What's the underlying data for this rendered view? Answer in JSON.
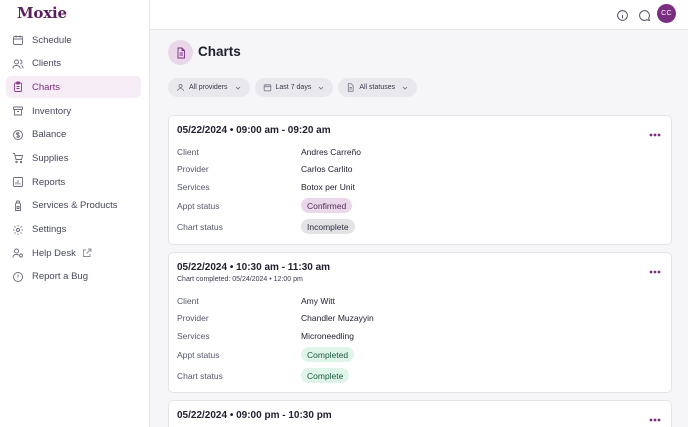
{
  "app": {
    "logo": "Moxie"
  },
  "sidebar": {
    "items": [
      {
        "label": "Schedule",
        "icon": "calendar-icon"
      },
      {
        "label": "Clients",
        "icon": "users-icon"
      },
      {
        "label": "Charts",
        "icon": "clipboard-icon",
        "active": true
      },
      {
        "label": "Inventory",
        "icon": "archive-box-icon"
      },
      {
        "label": "Balance",
        "icon": "dollar-circle-icon"
      },
      {
        "label": "Supplies",
        "icon": "cart-icon"
      },
      {
        "label": "Reports",
        "icon": "bar-chart-icon"
      },
      {
        "label": "Services & Products",
        "icon": "bottle-icon"
      },
      {
        "label": "Settings",
        "icon": "gear-icon"
      },
      {
        "label": "Help Desk",
        "icon": "help-desk-icon"
      },
      {
        "label": "Report a Bug",
        "icon": "alert-circle-icon"
      }
    ]
  },
  "topbar": {
    "avatar_initials": "CC"
  },
  "page": {
    "title": "Charts"
  },
  "filters": {
    "provider": "All providers",
    "date_range": "Last 7 days",
    "status": "All statuses"
  },
  "labels": {
    "client": "Client",
    "provider": "Provider",
    "services": "Services",
    "appt_status": "Appt status",
    "chart_status": "Chart status"
  },
  "charts": [
    {
      "title": "05/22/2024 • 09:00 am - 09:20 am",
      "completed": "",
      "client": "Andres Carreño",
      "provider": "Carlos Carlito",
      "services": "Botox per Unit",
      "appt_status": "Confirmed",
      "chart_status": "Incomplete"
    },
    {
      "title": "05/22/2024 • 10:30 am - 11:30 am",
      "completed": "Chart completed: 05/24/2024 • 12:00 pm",
      "client": "Amy Witt",
      "provider": "Chandler Muzayyin",
      "services": "Microneedling",
      "appt_status": "Completed",
      "chart_status": "Complete"
    },
    {
      "title": "05/22/2024 • 09:00 pm - 10:30 pm"
    }
  ],
  "colors": {
    "brand": "#7a2e80",
    "active_bg": "#f6ecf5",
    "badge_purple": "#ead8ea",
    "badge_gray": "#e3e3e6",
    "badge_green": "#dff5ea"
  }
}
